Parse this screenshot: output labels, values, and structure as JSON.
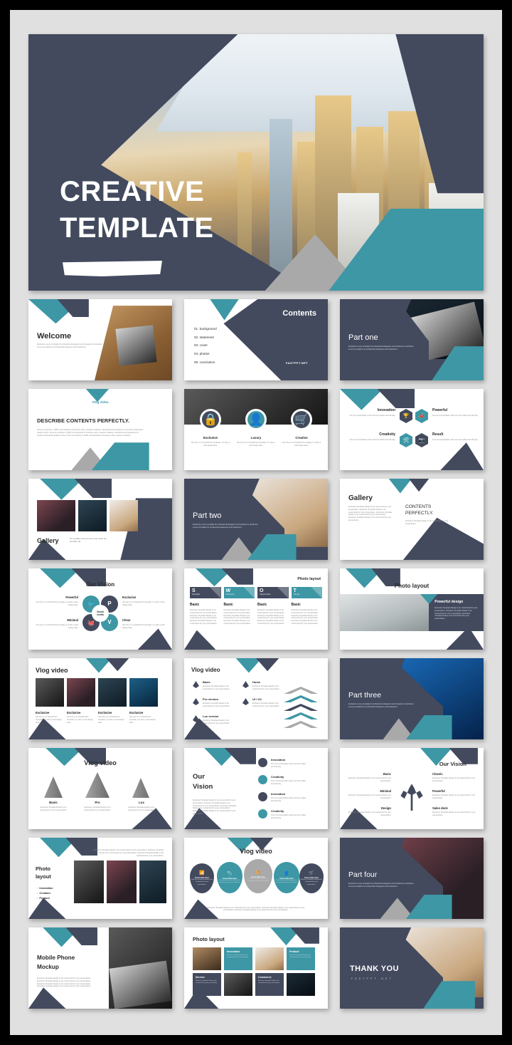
{
  "meta": {
    "brand": "FASTPPT.NET",
    "accent_teal": "#3d97a5",
    "accent_dark": "#434a5e",
    "accent_grey": "#a9a9a9",
    "page_bg": "#e0e0e0"
  },
  "hero": {
    "title_line1": "CREATIVE",
    "title_line2": "TEMPLATE"
  },
  "body_text": {
    "short": "Exclusive Luxury template for professional designers and freelancers. Exclusive Luxury templates for professional designers and freelancers.",
    "long": "Since its inception in 1996, has handreds of business units, research institutes, educational and equipment to provide professional quality service. Since its inception in 1996, has handreds of business units, research institutes, educational and equipment to provide professional quality service. Since its inception in 1996, has handreds of business units, research institutes.",
    "gallery": "Exclusive Template Ready to be customized for your presentation. Exclusive Template Ready to be customized for your presentation. Exclusive Template Ready to be customized for your presentation. Exclusive Template Ready to be customized for your presentation.",
    "swot_cell": "Exclusive Template Ready to be customized for your presentation. Exclusive Template Ready to be customized for your presentation. Exclusive Template Ready to be customized for your presentation.",
    "micro": "Not only is it a PowerPoint template, it is also a web design idea.",
    "micro2": "Text of a perspicable under and two visitas and will stay.",
    "micro3": "Exclusive Template Ready to be customized for your presentation.",
    "photo_caption": "Exclusive Template Ready to be customized for your presentation. Exclusive Template Ready to be customized for your presentation. Exclusive Template Ready to be customized for your presentation.",
    "bubble_footer": "Exclusive Template Ready to be customized for your presentation. Exclusive Template Ready to be customized for your presentation. Exclusive Template Ready to be customized for your presentation."
  },
  "slides": {
    "welcome": {
      "title": "Welcome"
    },
    "contents": {
      "title": "Contents",
      "items": [
        "01.  background",
        "02.  statement",
        "03.  cover",
        "04.  photos",
        "05.  conclusion"
      ],
      "brand": "FASTPPT.NET"
    },
    "part_one": {
      "title": "Part one"
    },
    "describe": {
      "kicker": "Vlog video",
      "title": "DESCRIBE CONTENTS PERFECTLY."
    },
    "circles": {
      "items": [
        {
          "label": "Exclusive",
          "icon": "lock-icon",
          "color": "dark"
        },
        {
          "label": "Luxury",
          "icon": "user-add-icon",
          "color": "teal"
        },
        {
          "label": "Creative",
          "icon": "cart-icon",
          "color": "dark"
        }
      ]
    },
    "hexagons": {
      "items": [
        {
          "label": "Innovation",
          "icon": "trophy-icon",
          "color": "dark",
          "side": "left"
        },
        {
          "label": "Powerful",
          "icon": "rocket-icon",
          "color": "teal",
          "side": "right"
        },
        {
          "label": "Creativity",
          "icon": "tools-icon",
          "color": "teal",
          "side": "left"
        },
        {
          "label": "Result",
          "icon": "camera-icon",
          "color": "dark",
          "side": "right"
        }
      ]
    },
    "gallery_a": {
      "title": "Gallery",
      "caption": "On a scale of one to ten, how much do you like me."
    },
    "part_two": {
      "title": "Part two"
    },
    "gallery_b": {
      "title": "Gallery",
      "subtitle_line1": "CONTENTS",
      "subtitle_line2": "PERFECTLY."
    },
    "vision_social": {
      "title": "Our Vision",
      "center_line1": "Social",
      "center_line2": "media",
      "petals": [
        {
          "label": "Powerful",
          "icon": "twitter-icon",
          "color": "teal"
        },
        {
          "label": "Exclusive",
          "icon": "pinterest-icon",
          "color": "dark"
        },
        {
          "label": "Minimal",
          "icon": "github-icon",
          "color": "dark"
        },
        {
          "label": "Clean",
          "icon": "vimeo-icon",
          "color": "teal"
        }
      ]
    },
    "swot": {
      "title": "Photo layout",
      "columns": [
        {
          "letter": "S",
          "word": "Strengths",
          "color": "dark",
          "heading": "Basic"
        },
        {
          "letter": "W",
          "word": "Weakness",
          "color": "teal",
          "heading": "Basic"
        },
        {
          "letter": "O",
          "word": "Opportunities",
          "color": "dark",
          "heading": "Basic"
        },
        {
          "letter": "T",
          "word": "Threats",
          "color": "teal",
          "heading": "Basic"
        }
      ]
    },
    "photo_plant": {
      "title": "Photo layout",
      "panel_title": "Powerful design"
    },
    "vlog_grid": {
      "title": "Vlog video",
      "items": [
        {
          "label": "Exclusive"
        },
        {
          "label": "Exclusive"
        },
        {
          "label": "Exclusive"
        },
        {
          "label": "Exclusive"
        }
      ]
    },
    "vlog_arrows": {
      "title": "Vlog video",
      "items": [
        {
          "label": "Basic"
        },
        {
          "label": "Home"
        },
        {
          "label": "Pro version"
        },
        {
          "label": "UI / UX"
        },
        {
          "label": "Lux version"
        }
      ]
    },
    "part_three": {
      "title": "Part three"
    },
    "vlog_cones": {
      "title": "Vlog video",
      "items": [
        {
          "label": "Basic"
        },
        {
          "label": "Pro"
        },
        {
          "label": "Lux"
        }
      ]
    },
    "vision_dots": {
      "title_line1": "Our",
      "title_line2": "Vision",
      "items": [
        {
          "label": "Innovation",
          "color": "dark"
        },
        {
          "label": "Creativity",
          "color": "teal"
        },
        {
          "label": "Innovation",
          "color": "dark"
        },
        {
          "label": "Creativity",
          "color": "teal"
        }
      ]
    },
    "vision_tree": {
      "title": "Our Vision",
      "left": [
        {
          "label": "Basic"
        },
        {
          "label": "Minimal"
        },
        {
          "label": "Design"
        }
      ],
      "right": [
        {
          "label": "Classic"
        },
        {
          "label": "Powerful"
        },
        {
          "label": "Sales deck"
        }
      ]
    },
    "photo_bullets": {
      "title_line1": "Photo",
      "title_line2": "layout",
      "bullets": [
        "Innovation",
        "Creation",
        "Product"
      ]
    },
    "vlog_bubbles": {
      "title": "Vlog video",
      "items": [
        {
          "label": "Insert title here",
          "icon": "wifi-icon",
          "color": "dark"
        },
        {
          "label": "Insert title here",
          "icon": "tag-icon",
          "color": "teal"
        },
        {
          "label": "Insert title here",
          "icon": "basket-icon",
          "color": "grey"
        },
        {
          "label": "Insert title here",
          "icon": "person-icon",
          "color": "teal"
        },
        {
          "label": "Insert title here",
          "icon": "cart-icon",
          "color": "dark"
        }
      ]
    },
    "part_four": {
      "title": "Part four"
    },
    "mobile_mockup": {
      "title_line1": "Mobile Phone",
      "title_line2": "Mockup"
    },
    "photo_grid": {
      "title": "Photo layout",
      "tiles": [
        {
          "label": "",
          "kind": "photo",
          "tone": "c"
        },
        {
          "label": "Innovation",
          "kind": "teal"
        },
        {
          "label": "",
          "kind": "photo",
          "tone": "dog"
        },
        {
          "label": "Product",
          "kind": "teal"
        },
        {
          "label": "Service",
          "kind": "dark"
        },
        {
          "label": "",
          "kind": "photo",
          "tone": "e"
        },
        {
          "label": "Commerce",
          "kind": "dark"
        },
        {
          "label": "",
          "kind": "photo",
          "tone": "d"
        }
      ]
    },
    "thank_you": {
      "title": "THANK YOU",
      "brand": "F A S T P P T . N E T"
    }
  }
}
